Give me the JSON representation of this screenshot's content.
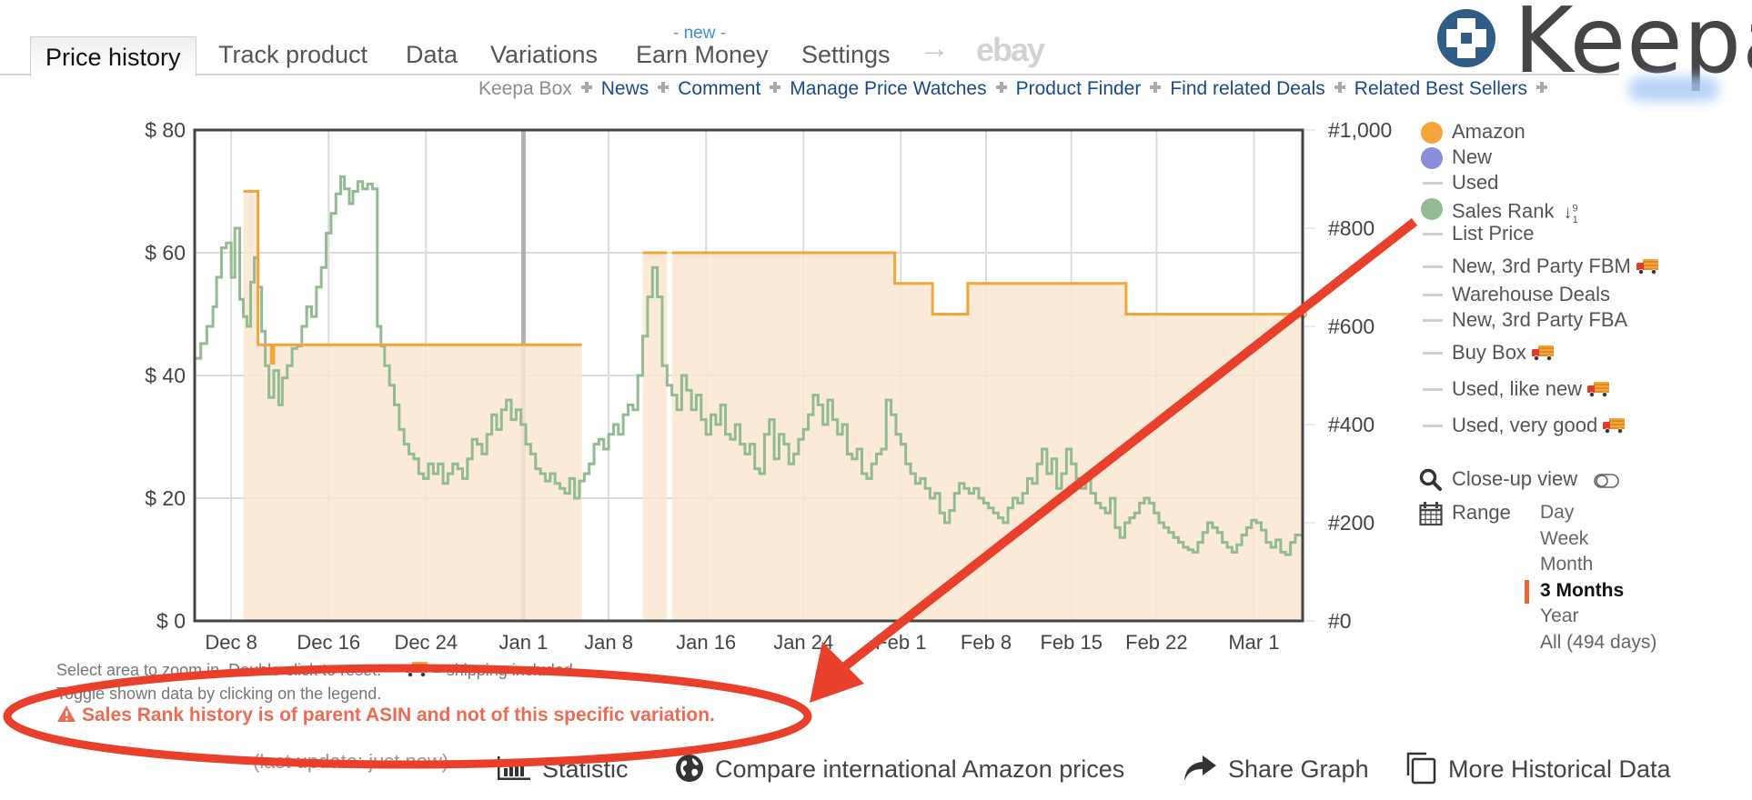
{
  "tabs": {
    "items": [
      {
        "label": "Price history",
        "active": true
      },
      {
        "label": "Track product"
      },
      {
        "label": "Data"
      },
      {
        "label": "Variations"
      },
      {
        "label": "Earn Money",
        "badge": "new"
      },
      {
        "label": "Settings"
      }
    ],
    "badge_prefix": "- ",
    "badge_suffix": " -",
    "arrow": "→",
    "ebay": "ebay"
  },
  "subnav": {
    "items": [
      "Keepa Box",
      "News",
      "Comment",
      "Manage Price Watches",
      "Product Finder",
      "Find related Deals",
      "Related Best Sellers"
    ]
  },
  "logo": {
    "text": "Keepa"
  },
  "legend": {
    "items": [
      {
        "label": "Amazon",
        "marker": "dot",
        "color": "#f4a43a"
      },
      {
        "label": "New",
        "marker": "dot",
        "color": "#8a8cdc"
      },
      {
        "label": "Used",
        "marker": "dash"
      },
      {
        "label": "Sales Rank",
        "marker": "dot",
        "color": "#92bb92",
        "sort_icon": true
      },
      {
        "label": "List Price",
        "marker": "dash"
      },
      {
        "label": "New, 3rd Party FBM",
        "marker": "dash",
        "truck": true
      },
      {
        "label": "Warehouse Deals",
        "marker": "dash"
      },
      {
        "label": "New, 3rd Party FBA",
        "marker": "dash"
      },
      {
        "label": "Buy Box",
        "marker": "dash",
        "truck": true
      },
      {
        "label": "Used, like new",
        "marker": "dash",
        "truck": true
      },
      {
        "label": "Used, very good",
        "marker": "dash",
        "truck": true
      }
    ],
    "sort_icon_text": "↓",
    "sort_sup": "9",
    "sort_sub": "1"
  },
  "controls": {
    "closeup_label": "Close-up view",
    "closeup_enabled": false,
    "range_label": "Range",
    "range_options": [
      "Day",
      "Week",
      "Month",
      "3 Months",
      "Year",
      "All (494 days)"
    ],
    "range_selected": "3 Months"
  },
  "notes": {
    "line1_a": "Select area to zoom in. Double-click to reset.",
    "line1_b": "= shipping included",
    "line2": "Toggle shown data by clicking on the legend.",
    "warning": "Sales Rank history is of parent ASIN and not of this specific variation.",
    "last_update": "(last update: just now)"
  },
  "actions": [
    {
      "label": "Statistic",
      "icon": "bar-chart-icon"
    },
    {
      "label": "Compare international Amazon prices",
      "icon": "globe-icon"
    },
    {
      "label": "Share Graph",
      "icon": "share-icon"
    },
    {
      "label": "More Historical Data",
      "icon": "copy-icon"
    }
  ],
  "annotation": {
    "color": "#e8402a"
  },
  "chart_data": {
    "type": "line",
    "title": "",
    "x_start": "2023-12-05",
    "x_end": "2024-03-05",
    "x_ticks": [
      {
        "label": "Dec 8",
        "day": 3
      },
      {
        "label": "Dec 16",
        "day": 11
      },
      {
        "label": "Dec 24",
        "day": 19
      },
      {
        "label": "Jan 1",
        "day": 27
      },
      {
        "label": "Jan 8",
        "day": 34
      },
      {
        "label": "Jan 16",
        "day": 42
      },
      {
        "label": "Jan 24",
        "day": 50
      },
      {
        "label": "Feb 1",
        "day": 58
      },
      {
        "label": "Feb 8",
        "day": 65
      },
      {
        "label": "Feb 15",
        "day": 72
      },
      {
        "label": "Feb 22",
        "day": 79
      },
      {
        "label": "Mar 1",
        "day": 87
      }
    ],
    "x_range_days": [
      0,
      91
    ],
    "left_axis": {
      "ticks": [
        "$ 0",
        "$ 20",
        "$ 40",
        "$ 60",
        "$ 80"
      ],
      "values": [
        0,
        20,
        40,
        60,
        80
      ],
      "range": [
        0,
        80
      ]
    },
    "right_axis": {
      "ticks": [
        "#0",
        "#200",
        "#400",
        "#600",
        "#800",
        "#1,000"
      ],
      "values": [
        0,
        200,
        400,
        600,
        800,
        1000
      ],
      "range": [
        0,
        1000
      ]
    },
    "grid": true,
    "year_marker_day": 27,
    "series": [
      {
        "name": "Amazon",
        "color": "#f4a43a",
        "fill": "#fbe6d2",
        "axis": "left",
        "step": true,
        "segments": [
          [
            [
              4,
              70
            ],
            [
              5.2,
              70
            ],
            [
              5.2,
              45
            ],
            [
              6.3,
              45
            ],
            [
              6.3,
              42
            ],
            [
              6.5,
              42
            ],
            [
              6.5,
              45
            ],
            [
              31.8,
              45
            ]
          ],
          [
            [
              36.8,
              60
            ],
            [
              38.8,
              60
            ]
          ],
          [
            [
              39.2,
              60
            ],
            [
              57.5,
              60
            ],
            [
              57.5,
              55
            ],
            [
              60.6,
              55
            ],
            [
              60.6,
              50
            ],
            [
              63.5,
              50
            ],
            [
              63.5,
              55
            ],
            [
              76.5,
              55
            ],
            [
              76.5,
              50
            ],
            [
              91,
              50
            ]
          ]
        ]
      },
      {
        "name": "Sales Rank",
        "color": "#92bb92",
        "axis": "right",
        "step": true,
        "points": [
          [
            0,
            535
          ],
          [
            0.5,
            565
          ],
          [
            1,
            600
          ],
          [
            1.5,
            640
          ],
          [
            1.8,
            700
          ],
          [
            2.2,
            760
          ],
          [
            2.6,
            770
          ],
          [
            3,
            700
          ],
          [
            3.3,
            800
          ],
          [
            3.7,
            655
          ],
          [
            4,
            620
          ],
          [
            4.3,
            600
          ],
          [
            4.6,
            690
          ],
          [
            4.9,
            740
          ],
          [
            5.2,
            680
          ],
          [
            5.5,
            590
          ],
          [
            5.8,
            520
          ],
          [
            6.1,
            455
          ],
          [
            6.5,
            510
          ],
          [
            6.9,
            440
          ],
          [
            7.2,
            495
          ],
          [
            7.6,
            520
          ],
          [
            8,
            555
          ],
          [
            8.4,
            560
          ],
          [
            8.8,
            600
          ],
          [
            9.2,
            640
          ],
          [
            9.6,
            620
          ],
          [
            10,
            680
          ],
          [
            10.4,
            720
          ],
          [
            10.8,
            790
          ],
          [
            11.2,
            830
          ],
          [
            11.6,
            870
          ],
          [
            12,
            905
          ],
          [
            12.3,
            880
          ],
          [
            12.7,
            850
          ],
          [
            13,
            875
          ],
          [
            13.4,
            895
          ],
          [
            13.8,
            880
          ],
          [
            14.2,
            890
          ],
          [
            14.6,
            880
          ],
          [
            15,
            600
          ],
          [
            15.3,
            560
          ],
          [
            15.6,
            520
          ],
          [
            16,
            480
          ],
          [
            16.4,
            440
          ],
          [
            16.8,
            390
          ],
          [
            17.2,
            360
          ],
          [
            17.6,
            340
          ],
          [
            18,
            330
          ],
          [
            18.4,
            300
          ],
          [
            18.8,
            290
          ],
          [
            19.2,
            320
          ],
          [
            19.6,
            300
          ],
          [
            20,
            320
          ],
          [
            20.4,
            280
          ],
          [
            20.8,
            300
          ],
          [
            21.2,
            320
          ],
          [
            21.6,
            310
          ],
          [
            22,
            290
          ],
          [
            22.4,
            330
          ],
          [
            22.8,
            370
          ],
          [
            23.2,
            360
          ],
          [
            23.6,
            340
          ],
          [
            24,
            380
          ],
          [
            24.4,
            420
          ],
          [
            24.8,
            390
          ],
          [
            25.2,
            430
          ],
          [
            25.6,
            450
          ],
          [
            26,
            410
          ],
          [
            26.4,
            430
          ],
          [
            26.8,
            400
          ],
          [
            27.2,
            360
          ],
          [
            27.6,
            340
          ],
          [
            28,
            310
          ],
          [
            28.4,
            300
          ],
          [
            28.8,
            285
          ],
          [
            29.2,
            300
          ],
          [
            29.6,
            280
          ],
          [
            30,
            270
          ],
          [
            30.4,
            260
          ],
          [
            30.8,
            290
          ],
          [
            31.2,
            250
          ],
          [
            31.6,
            285
          ],
          [
            32,
            300
          ],
          [
            32.4,
            320
          ],
          [
            32.8,
            360
          ],
          [
            33.2,
            370
          ],
          [
            33.6,
            350
          ],
          [
            34,
            380
          ],
          [
            34.4,
            400
          ],
          [
            34.8,
            380
          ],
          [
            35.2,
            420
          ],
          [
            35.6,
            440
          ],
          [
            36,
            430
          ],
          [
            36.4,
            500
          ],
          [
            36.8,
            580
          ],
          [
            37.2,
            660
          ],
          [
            37.6,
            720
          ],
          [
            38,
            660
          ],
          [
            38.4,
            520
          ],
          [
            38.8,
            480
          ],
          [
            39.2,
            460
          ],
          [
            39.6,
            430
          ],
          [
            40,
            500
          ],
          [
            40.4,
            470
          ],
          [
            40.8,
            430
          ],
          [
            41.2,
            460
          ],
          [
            41.6,
            410
          ],
          [
            42,
            380
          ],
          [
            42.4,
            420
          ],
          [
            42.8,
            400
          ],
          [
            43.2,
            440
          ],
          [
            43.6,
            380
          ],
          [
            44,
            370
          ],
          [
            44.4,
            400
          ],
          [
            44.8,
            360
          ],
          [
            45.2,
            340
          ],
          [
            45.6,
            360
          ],
          [
            46,
            310
          ],
          [
            46.4,
            300
          ],
          [
            46.8,
            380
          ],
          [
            47.2,
            410
          ],
          [
            47.6,
            330
          ],
          [
            48,
            380
          ],
          [
            48.4,
            360
          ],
          [
            48.8,
            320
          ],
          [
            49.2,
            340
          ],
          [
            49.6,
            370
          ],
          [
            50,
            390
          ],
          [
            50.4,
            420
          ],
          [
            50.8,
            460
          ],
          [
            51.2,
            440
          ],
          [
            51.6,
            400
          ],
          [
            52,
            450
          ],
          [
            52.4,
            410
          ],
          [
            52.8,
            380
          ],
          [
            53.2,
            400
          ],
          [
            53.6,
            340
          ],
          [
            54,
            330
          ],
          [
            54.4,
            350
          ],
          [
            54.8,
            300
          ],
          [
            55.2,
            290
          ],
          [
            55.6,
            320
          ],
          [
            56,
            340
          ],
          [
            56.4,
            350
          ],
          [
            56.8,
            450
          ],
          [
            57.2,
            420
          ],
          [
            57.6,
            380
          ],
          [
            58,
            360
          ],
          [
            58.4,
            320
          ],
          [
            58.8,
            300
          ],
          [
            59.2,
            280
          ],
          [
            59.6,
            290
          ],
          [
            60,
            270
          ],
          [
            60.4,
            250
          ],
          [
            60.8,
            260
          ],
          [
            61.2,
            220
          ],
          [
            61.6,
            200
          ],
          [
            62,
            225
          ],
          [
            62.4,
            260
          ],
          [
            62.8,
            280
          ],
          [
            63.2,
            270
          ],
          [
            63.6,
            260
          ],
          [
            64,
            270
          ],
          [
            64.4,
            250
          ],
          [
            64.8,
            240
          ],
          [
            65.2,
            230
          ],
          [
            65.6,
            220
          ],
          [
            66,
            210
          ],
          [
            66.4,
            200
          ],
          [
            66.8,
            230
          ],
          [
            67.2,
            250
          ],
          [
            67.6,
            240
          ],
          [
            68,
            260
          ],
          [
            68.4,
            290
          ],
          [
            68.8,
            280
          ],
          [
            69.2,
            320
          ],
          [
            69.6,
            350
          ],
          [
            70,
            300
          ],
          [
            70.4,
            330
          ],
          [
            70.8,
            270
          ],
          [
            71.2,
            300
          ],
          [
            71.6,
            350
          ],
          [
            72,
            320
          ],
          [
            72.4,
            290
          ],
          [
            72.8,
            270
          ],
          [
            73.2,
            290
          ],
          [
            73.6,
            260
          ],
          [
            74,
            240
          ],
          [
            74.4,
            230
          ],
          [
            74.8,
            220
          ],
          [
            75.2,
            250
          ],
          [
            75.6,
            190
          ],
          [
            76,
            170
          ],
          [
            76.4,
            200
          ],
          [
            76.8,
            210
          ],
          [
            77.2,
            220
          ],
          [
            77.6,
            240
          ],
          [
            78,
            250
          ],
          [
            78.4,
            240
          ],
          [
            78.8,
            220
          ],
          [
            79.2,
            200
          ],
          [
            79.6,
            190
          ],
          [
            80,
            180
          ],
          [
            80.4,
            170
          ],
          [
            80.8,
            160
          ],
          [
            81.2,
            150
          ],
          [
            81.6,
            145
          ],
          [
            82,
            140
          ],
          [
            82.4,
            160
          ],
          [
            82.8,
            180
          ],
          [
            83.2,
            200
          ],
          [
            83.6,
            190
          ],
          [
            84,
            180
          ],
          [
            84.4,
            160
          ],
          [
            84.8,
            150
          ],
          [
            85.2,
            140
          ],
          [
            85.6,
            155
          ],
          [
            86,
            175
          ],
          [
            86.4,
            190
          ],
          [
            86.8,
            205
          ],
          [
            87.2,
            200
          ],
          [
            87.6,
            185
          ],
          [
            88,
            160
          ],
          [
            88.4,
            150
          ],
          [
            88.8,
            165
          ],
          [
            89.2,
            140
          ],
          [
            89.6,
            135
          ],
          [
            90,
            160
          ],
          [
            90.4,
            175
          ],
          [
            91,
            175
          ]
        ]
      }
    ],
    "legend_position": "right"
  }
}
